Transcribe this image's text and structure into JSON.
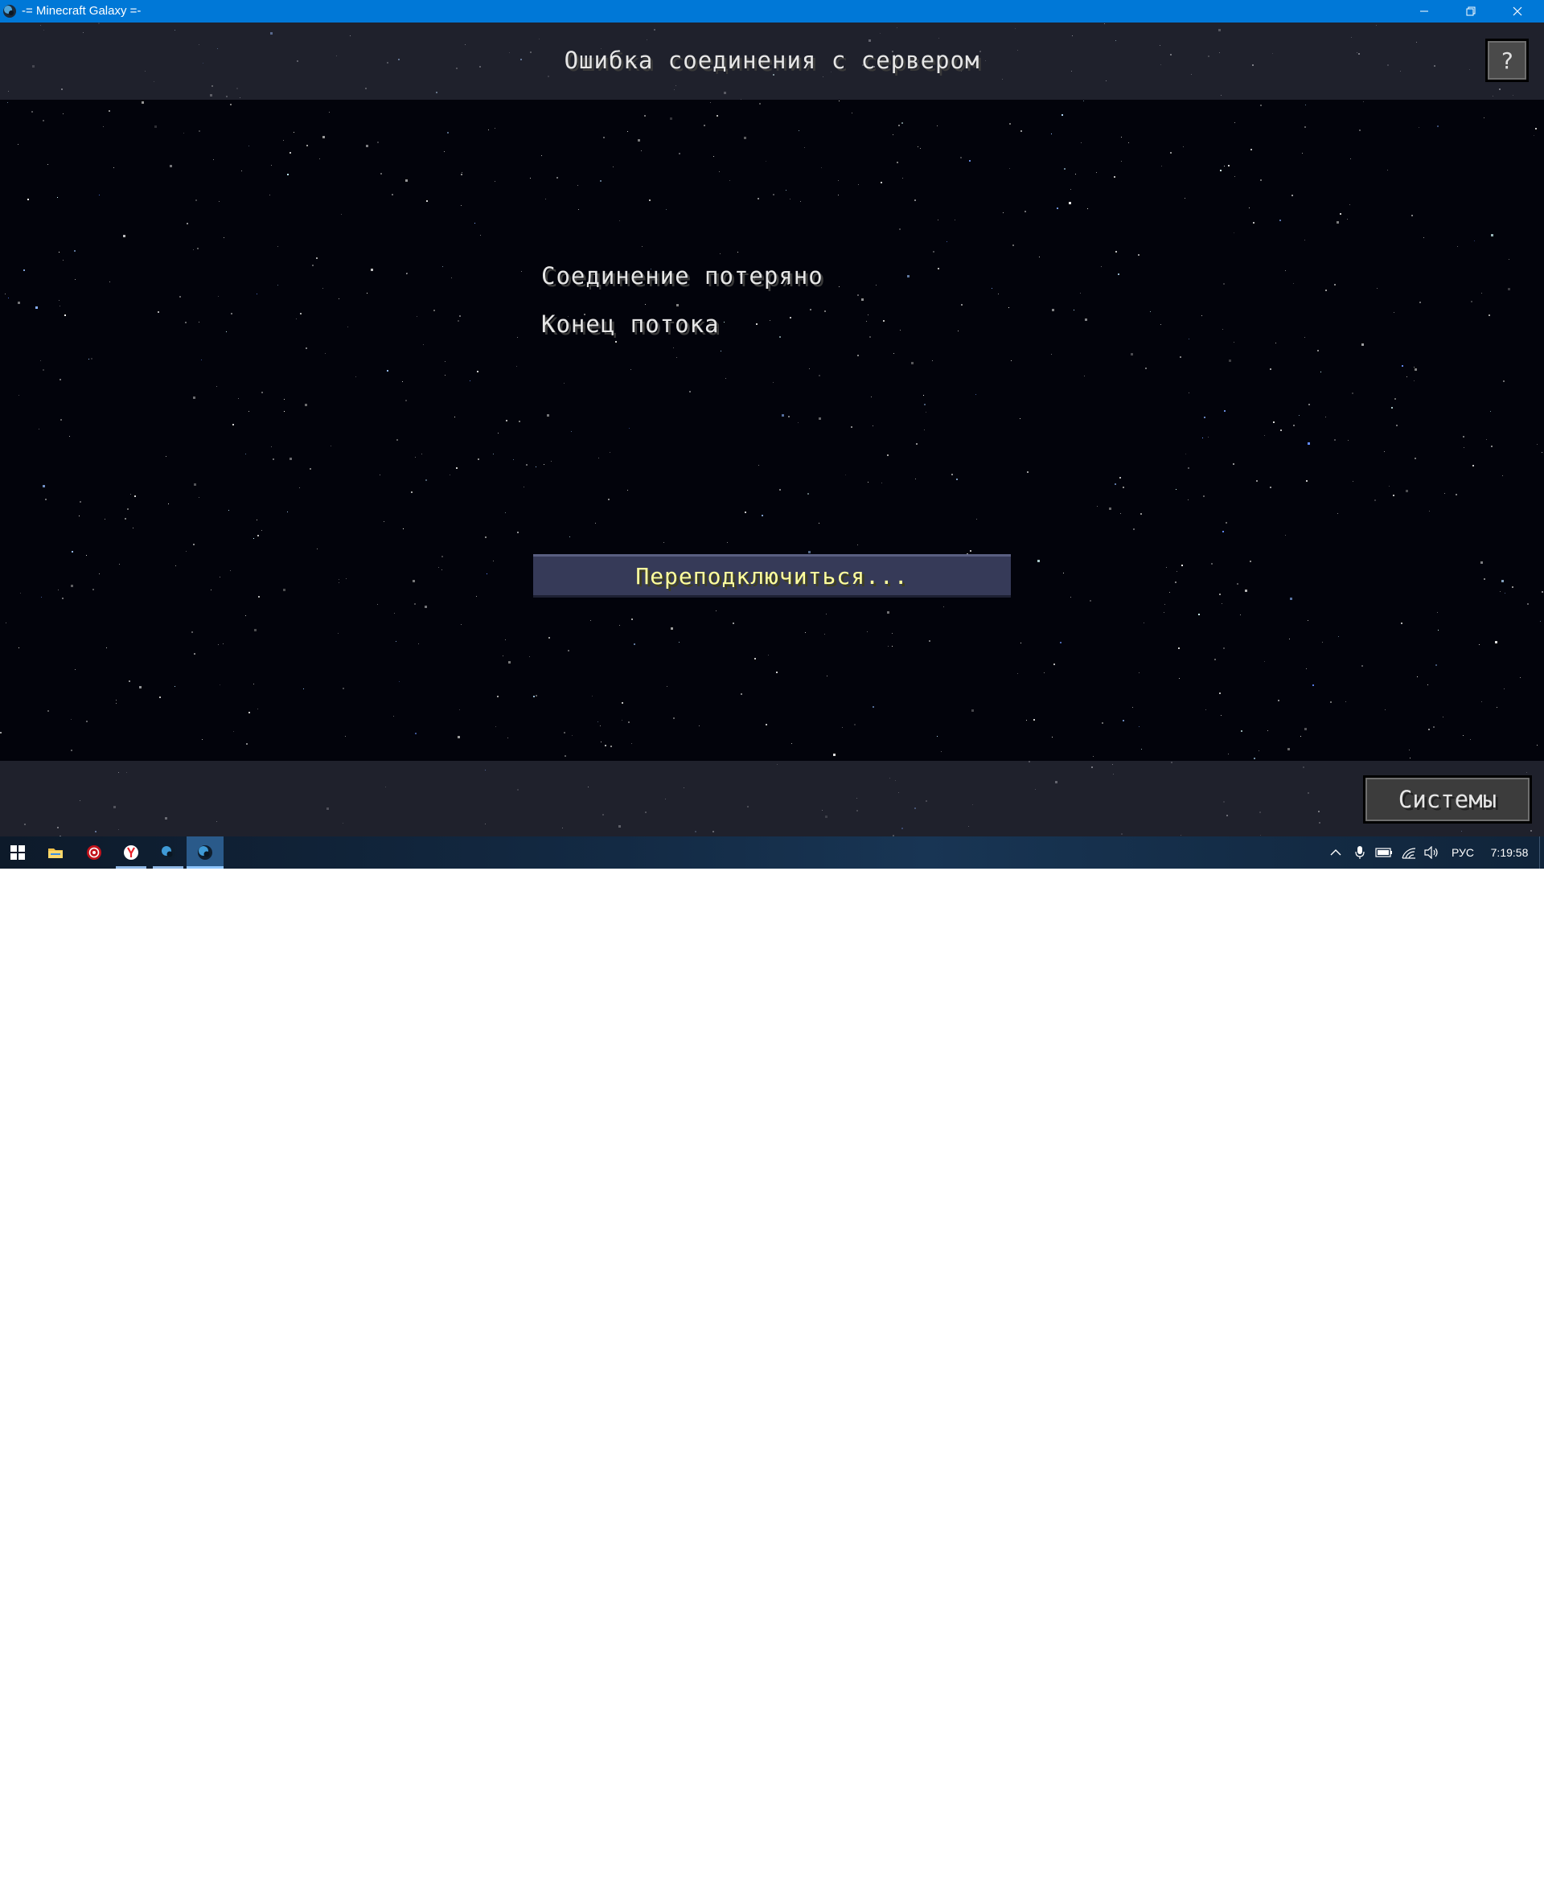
{
  "window": {
    "title": "-= Minecraft Galaxy =-",
    "accent": "#0078d7"
  },
  "screen": {
    "title": "Ошибка соединения с сервером",
    "help_label": "?",
    "messages": [
      "Соединение потеряно",
      "Конец потока"
    ],
    "reconnect_label": "Переподключиться...",
    "systems_label": "Системы"
  },
  "taskbar": {
    "apps": [
      {
        "icon": "windows-start-icon"
      },
      {
        "icon": "file-explorer-icon"
      },
      {
        "icon": "red-app-icon"
      },
      {
        "icon": "yandex-browser-icon"
      },
      {
        "icon": "minecraft-galaxy-icon"
      },
      {
        "icon": "minecraft-galaxy-icon"
      }
    ],
    "tray": {
      "language": "РУС",
      "time": "7:19:58"
    }
  }
}
